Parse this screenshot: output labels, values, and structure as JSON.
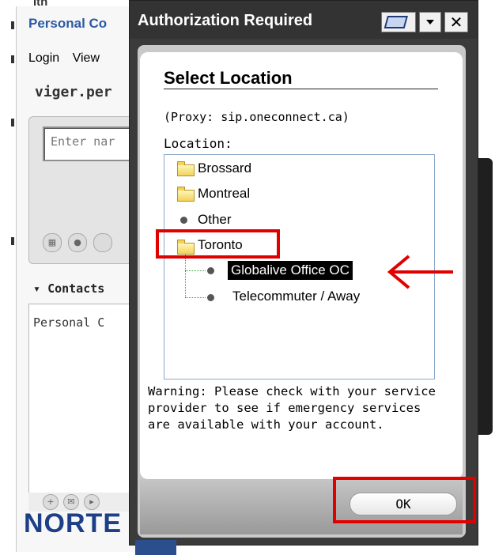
{
  "background_app": {
    "top_text": "Itn",
    "title": "Personal Co",
    "menu": [
      "Login",
      "View"
    ],
    "user": "viger.per",
    "search_placeholder": "Enter nar",
    "contacts_header": "Contacts",
    "contacts_list_item": "Personal C",
    "logo": "NORTE"
  },
  "dialog": {
    "title": "Authorization Required",
    "heading": "Select Location",
    "proxy_text": "(Proxy: sip.oneconnect.ca)",
    "location_label": "Location:",
    "tree": [
      {
        "label": "Brossard",
        "type": "folder"
      },
      {
        "label": "Montreal",
        "type": "folder"
      },
      {
        "label": "Other",
        "type": "item"
      },
      {
        "label": "Toronto",
        "type": "folder",
        "expanded": true
      },
      {
        "label": "Globalive Office OC",
        "type": "item",
        "selected": true
      },
      {
        "label": "Telecommuter / Away",
        "type": "item"
      }
    ],
    "warning": "Warning: Please check with your service provider to see if emergency services are available with your account.",
    "ok_label": "OK"
  },
  "colors": {
    "highlight": "#e00000",
    "selection_bg": "#000000",
    "dialog_frame": "#333333"
  }
}
